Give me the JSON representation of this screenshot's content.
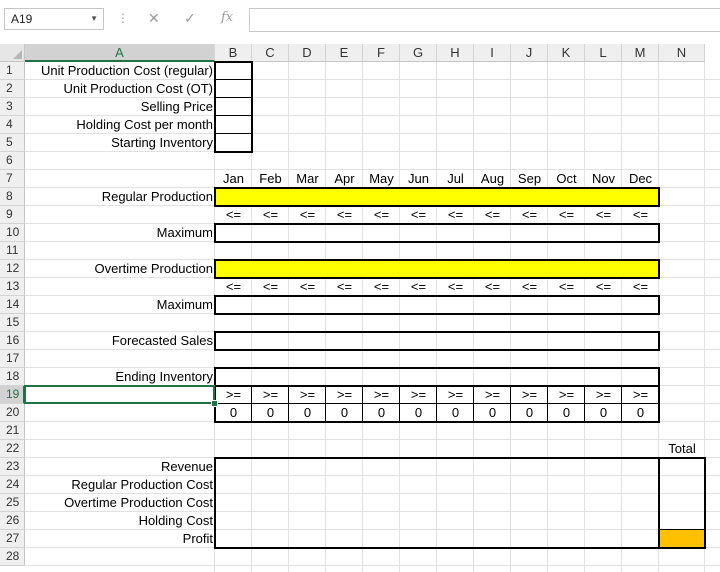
{
  "formula_bar": {
    "name_box": "A19",
    "formula": ""
  },
  "columns": [
    "A",
    "B",
    "C",
    "D",
    "E",
    "F",
    "G",
    "H",
    "I",
    "J",
    "K",
    "L",
    "M",
    "N"
  ],
  "rows": [
    "1",
    "2",
    "3",
    "4",
    "5",
    "6",
    "7",
    "8",
    "9",
    "10",
    "11",
    "12",
    "13",
    "14",
    "15",
    "16",
    "17",
    "18",
    "19",
    "20",
    "21",
    "22",
    "23",
    "24",
    "25",
    "26",
    "27",
    "28"
  ],
  "labels": {
    "r1": "Unit Production Cost (regular)",
    "r2": "Unit Production Cost (OT)",
    "r3": "Selling Price",
    "r4": "Holding Cost per month",
    "r5": "Starting Inventory",
    "r8": "Regular Production",
    "r10": "Maximum",
    "r12": "Overtime Production",
    "r14": "Maximum",
    "r16": "Forecasted Sales",
    "r18": "Ending Inventory",
    "r23": "Revenue",
    "r24": "Regular Production Cost",
    "r25": "Overtime Production Cost",
    "r26": "Holding Cost",
    "r27": "Profit"
  },
  "months": [
    "Jan",
    "Feb",
    "Mar",
    "Apr",
    "May",
    "Jun",
    "Jul",
    "Aug",
    "Sep",
    "Oct",
    "Nov",
    "Dec"
  ],
  "le_symbol": "<=",
  "ge_symbol": ">=",
  "row20_values": [
    "0",
    "0",
    "0",
    "0",
    "0",
    "0",
    "0",
    "0",
    "0",
    "0",
    "0",
    "0"
  ],
  "total_label": "Total",
  "colors": {
    "yellow": "#ffff00",
    "orange": "#ffc000",
    "selection": "#217346"
  }
}
